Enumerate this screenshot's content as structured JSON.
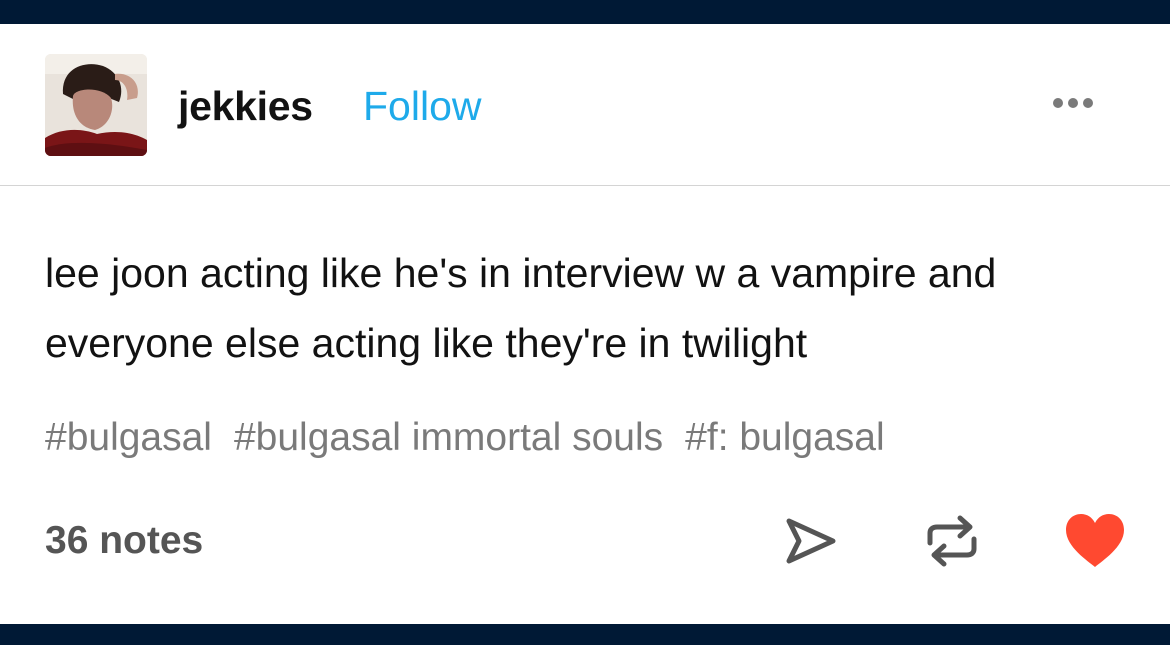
{
  "post": {
    "username": "jekkies",
    "follow_label": "Follow",
    "body": "lee joon acting like he's in interview w a vampire and everyone else acting like they're in twilight",
    "tags": [
      "#bulgasal",
      "#bulgasal immortal souls",
      "#f: bulgasal"
    ],
    "notes": "36 notes"
  },
  "icons": {
    "more": "more-horizontal-icon",
    "share": "share-send-icon",
    "reblog": "reblog-icon",
    "like": "heart-icon"
  },
  "colors": {
    "frame": "#001935",
    "follow": "#1eaaea",
    "tag": "#7a7a7a",
    "like": "#ff4930",
    "text": "#121212"
  }
}
